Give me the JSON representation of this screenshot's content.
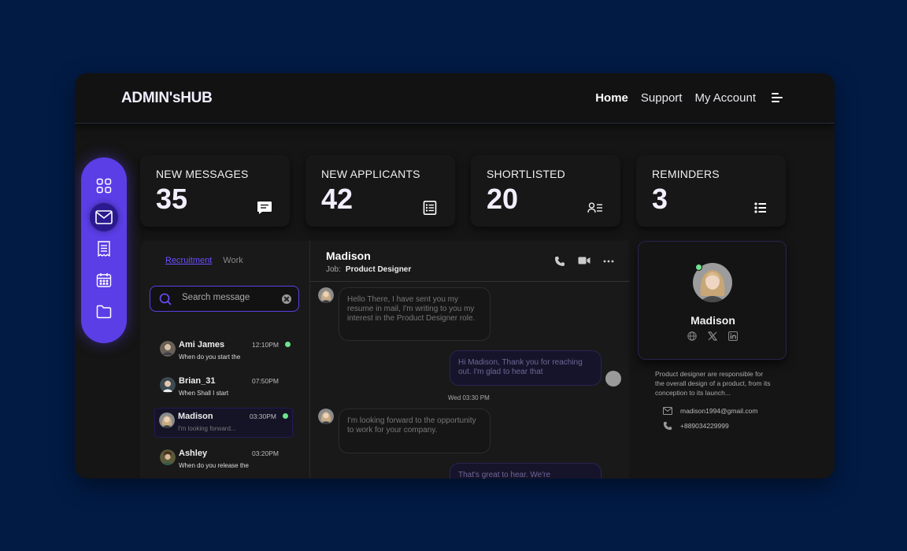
{
  "brand": "ADMIN'sHUB",
  "nav": {
    "home": "Home",
    "support": "Support",
    "account": "My Account"
  },
  "stats": [
    {
      "label": "NEW MESSAGES",
      "value": "35",
      "icon": "chat-icon"
    },
    {
      "label": "NEW APPLICANTS",
      "value": "42",
      "icon": "document-list-icon"
    },
    {
      "label": "SHORTLISTED",
      "value": "20",
      "icon": "user-list-icon"
    },
    {
      "label": "REMINDERS",
      "value": "3",
      "icon": "list-icon"
    }
  ],
  "sidebar": [
    "grid-icon",
    "mail-icon",
    "receipt-icon",
    "calendar-icon",
    "folder-icon"
  ],
  "inbox": {
    "tab_active": "Recruitment",
    "tab_other": "Work",
    "search_placeholder": "Search message",
    "conversations": [
      {
        "name": "Ami James",
        "time": "12:10PM",
        "preview": "When do you start the",
        "unread": true
      },
      {
        "name": "Brian_31",
        "time": "07:50PM",
        "preview": "When Shall I start",
        "unread": false
      },
      {
        "name": "Madison",
        "time": "03:30PM",
        "preview": "I'm looking forward...",
        "unread": true
      },
      {
        "name": "Ashley",
        "time": "03:20PM",
        "preview": "When do you release the",
        "unread": false
      }
    ]
  },
  "chat": {
    "name": "Madison",
    "job_label": "Job:",
    "job": "Product Designer",
    "messages": [
      {
        "from": "them",
        "text": "Hello There, I have sent you my resume in mail, I'm writing to you my interest in the Product Designer role."
      },
      {
        "from": "me",
        "text": "Hi Madison, Thank you for reaching out. I'm glad to hear that"
      },
      {
        "from": "them",
        "text": "I'm looking forward to the opportunity to work for your company."
      },
      {
        "from": "me",
        "text": "That's great to hear. We're"
      }
    ],
    "timestamp": "Wed 03:30 PM"
  },
  "profile": {
    "name": "Madison",
    "description": "Product designer are responsible for the overall design of a product, from its conception to its launch...",
    "email": "madison1994@gmail.com",
    "phone": "+889034229999"
  },
  "colors": {
    "accent": "#5b3ee6",
    "online": "#6ee38e",
    "background": "#021b45"
  }
}
